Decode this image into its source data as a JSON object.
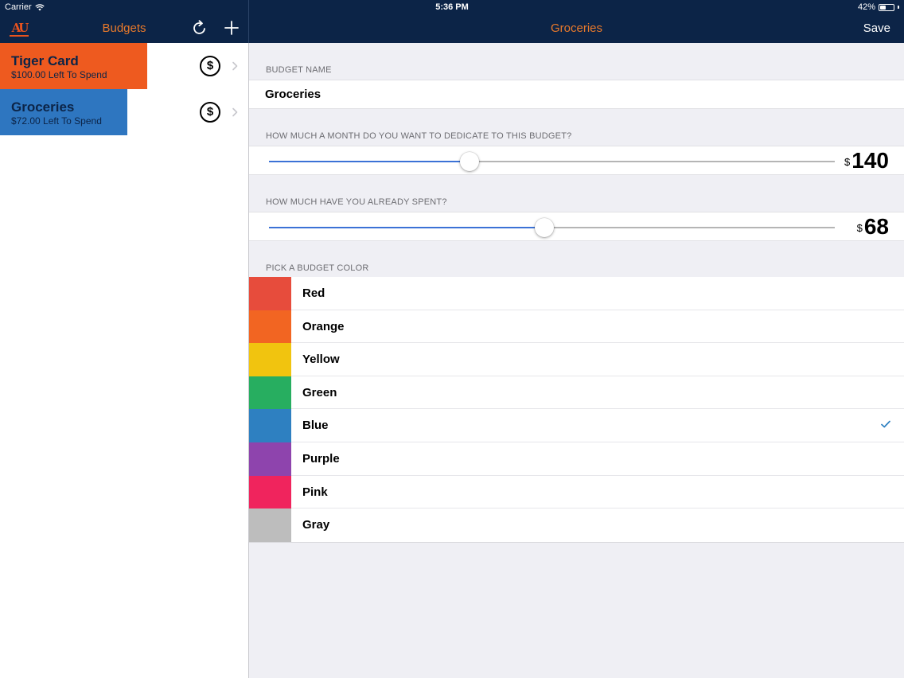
{
  "status_bar": {
    "carrier": "Carrier",
    "time": "5:36 PM",
    "battery": "42%",
    "battery_level": 0.42
  },
  "sidebar_nav": {
    "title": "Budgets",
    "refresh_icon": "refresh-icon",
    "add_icon": "plus-icon"
  },
  "budgets": [
    {
      "name": "Tiger Card",
      "left_to_spend": "$100.00 Left To Spend",
      "color": "#ee5a1f",
      "icon": "dollar-circle-icon"
    },
    {
      "name": "Groceries",
      "left_to_spend": "$72.00 Left To Spend",
      "color": "#2e76c0",
      "icon": "dollar-circle-icon"
    }
  ],
  "detail_nav": {
    "title": "Groceries",
    "save_label": "Save"
  },
  "budget_name": {
    "label": "BUDGET NAME",
    "value": "Groceries"
  },
  "monthly": {
    "label": "HOW MUCH A MONTH DO YOU WANT TO DEDICATE TO THIS BUDGET?",
    "currency": "$",
    "value": "140",
    "slider_fraction": 0.355
  },
  "spent": {
    "label": "HOW MUCH HAVE YOU ALREADY SPENT?",
    "currency": "$",
    "value": "68",
    "slider_fraction": 0.486
  },
  "color_picker": {
    "label": "PICK A BUDGET COLOR",
    "selected": "Blue",
    "colors": [
      {
        "name": "Red",
        "hex": "#e74c3c"
      },
      {
        "name": "Orange",
        "hex": "#f26522"
      },
      {
        "name": "Yellow",
        "hex": "#f1c40f"
      },
      {
        "name": "Green",
        "hex": "#27ae60"
      },
      {
        "name": "Blue",
        "hex": "#2e80c1"
      },
      {
        "name": "Purple",
        "hex": "#8e44ad"
      },
      {
        "name": "Pink",
        "hex": "#f0245d"
      },
      {
        "name": "Gray",
        "hex": "#bdbdbd"
      }
    ]
  },
  "accent_colors": {
    "navbar": "#0c2447",
    "title": "#e8792b",
    "slider": "#3b72d6"
  }
}
